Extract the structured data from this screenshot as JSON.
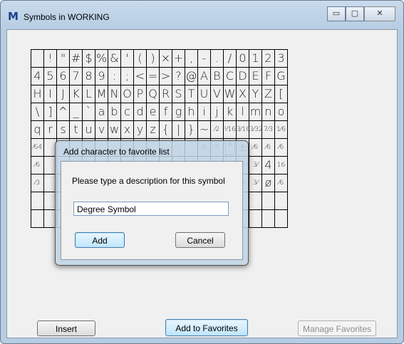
{
  "window": {
    "title": "Symbols in WORKING",
    "icon": "microstation-logo-icon",
    "controls": {
      "minimize": "▭",
      "maximize": "▢",
      "close": "✕"
    }
  },
  "symbols": {
    "rows": [
      [
        " ",
        "!",
        "\"",
        "#",
        "$",
        "%",
        "&",
        "'",
        "(",
        ")",
        "×",
        "+",
        ",",
        "-",
        ".",
        "/",
        "0",
        "1",
        "2",
        "3"
      ],
      [
        "4",
        "5",
        "6",
        "7",
        "8",
        "9",
        ":",
        ";",
        "<",
        "=",
        ">",
        "?",
        "@",
        "A",
        "B",
        "C",
        "D",
        "E",
        "F",
        "G"
      ],
      [
        "H",
        "I",
        "J",
        "K",
        "L",
        "M",
        "N",
        "O",
        "P",
        "Q",
        "R",
        "S",
        "T",
        "U",
        "V",
        "W",
        "X",
        "Y",
        "Z",
        "["
      ],
      [
        "\\",
        "]",
        "^",
        "_",
        "`",
        "a",
        "b",
        "c",
        "d",
        "e",
        "f",
        "g",
        "h",
        "i",
        "j",
        "k",
        "l",
        "m",
        "n",
        "o",
        "p"
      ],
      [
        "q",
        "r",
        "s",
        "t",
        "u",
        "v",
        "w",
        "x",
        "y",
        "z",
        "{",
        "|",
        "}",
        "~",
        "⁄2",
        "⅟16",
        "3⁄16",
        "3⁄32",
        "7⁄3",
        "1⁄6"
      ],
      [
        "⁄64",
        "",
        "",
        "",
        "",
        "",
        "",
        "",
        "",
        "",
        "",
        "",
        "",
        "⁄6",
        "⁄6",
        "°",
        "±",
        "⁄6",
        "⁄6",
        "⁄6"
      ],
      [
        "⁄6",
        "",
        "",
        "",
        "",
        "",
        "",
        "",
        "",
        "",
        "",
        "",
        "",
        "3⁄",
        "16",
        "3⁄",
        "3⁄16",
        "3⁄",
        "4",
        "16"
      ],
      [
        "⁄3",
        "",
        "",
        "",
        "",
        "",
        "",
        "",
        "",
        "",
        "",
        "",
        "",
        "8",
        "16",
        "16",
        "3⁄",
        "3⁄",
        "ø",
        "⁄6"
      ],
      [
        "",
        "",
        "",
        "",
        "",
        "",
        "",
        "",
        "",
        "",
        "",
        "",
        "",
        "",
        "",
        "",
        "",
        "",
        "",
        ""
      ],
      [
        "",
        "",
        "",
        "",
        "",
        "",
        "",
        "",
        "",
        "",
        "",
        "",
        "",
        "",
        "",
        "",
        "",
        "",
        "",
        ""
      ]
    ]
  },
  "buttons": {
    "insert": "Insert",
    "add_to_favorites": "Add to Favorites",
    "manage_favorites": "Manage Favorites"
  },
  "dialog": {
    "title": "Add character to favorite list",
    "prompt": "Please type a description for this symbol",
    "input_value": "Degree Symbol",
    "add": "Add",
    "cancel": "Cancel"
  }
}
